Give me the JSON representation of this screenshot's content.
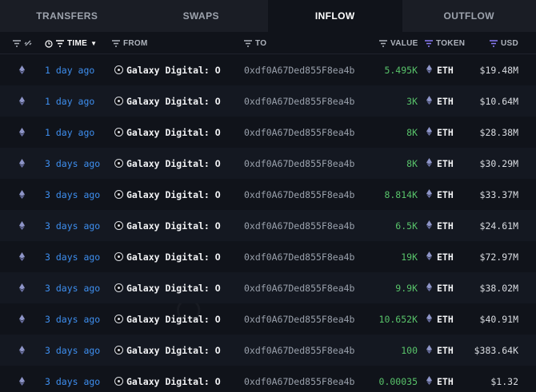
{
  "tabs": [
    {
      "label": "TRANSFERS",
      "active": false
    },
    {
      "label": "SWAPS",
      "active": false
    },
    {
      "label": "INFLOW",
      "active": true
    },
    {
      "label": "OUTFLOW",
      "active": false
    }
  ],
  "columns": {
    "time": "TIME",
    "from": "FROM",
    "to": "TO",
    "value": "VALUE",
    "token": "TOKEN",
    "usd": "USD"
  },
  "colors": {
    "time_link": "#3e8ff0",
    "value_green": "#58c36a",
    "token_filter_accent": "#8b7cf6"
  },
  "rows": [
    {
      "time": "1 day ago",
      "from": "Galaxy Digital: O",
      "to": "0xdf0A67Ded855F8ea4b",
      "value": "5.495K",
      "token": "ETH",
      "usd": "$19.48M"
    },
    {
      "time": "1 day ago",
      "from": "Galaxy Digital: O",
      "to": "0xdf0A67Ded855F8ea4b",
      "value": "3K",
      "token": "ETH",
      "usd": "$10.64M"
    },
    {
      "time": "1 day ago",
      "from": "Galaxy Digital: O",
      "to": "0xdf0A67Ded855F8ea4b",
      "value": "8K",
      "token": "ETH",
      "usd": "$28.38M"
    },
    {
      "time": "3 days ago",
      "from": "Galaxy Digital: O",
      "to": "0xdf0A67Ded855F8ea4b",
      "value": "8K",
      "token": "ETH",
      "usd": "$30.29M"
    },
    {
      "time": "3 days ago",
      "from": "Galaxy Digital: O",
      "to": "0xdf0A67Ded855F8ea4b",
      "value": "8.814K",
      "token": "ETH",
      "usd": "$33.37M"
    },
    {
      "time": "3 days ago",
      "from": "Galaxy Digital: O",
      "to": "0xdf0A67Ded855F8ea4b",
      "value": "6.5K",
      "token": "ETH",
      "usd": "$24.61M"
    },
    {
      "time": "3 days ago",
      "from": "Galaxy Digital: O",
      "to": "0xdf0A67Ded855F8ea4b",
      "value": "19K",
      "token": "ETH",
      "usd": "$72.97M"
    },
    {
      "time": "3 days ago",
      "from": "Galaxy Digital: O",
      "to": "0xdf0A67Ded855F8ea4b",
      "value": "9.9K",
      "token": "ETH",
      "usd": "$38.02M"
    },
    {
      "time": "3 days ago",
      "from": "Galaxy Digital: O",
      "to": "0xdf0A67Ded855F8ea4b",
      "value": "10.652K",
      "token": "ETH",
      "usd": "$40.91M"
    },
    {
      "time": "3 days ago",
      "from": "Galaxy Digital: O",
      "to": "0xdf0A67Ded855F8ea4b",
      "value": "100",
      "token": "ETH",
      "usd": "$383.64K"
    },
    {
      "time": "3 days ago",
      "from": "Galaxy Digital: O",
      "to": "0xdf0A67Ded855F8ea4b",
      "value": "0.00035",
      "token": "ETH",
      "usd": "$1.32"
    }
  ]
}
